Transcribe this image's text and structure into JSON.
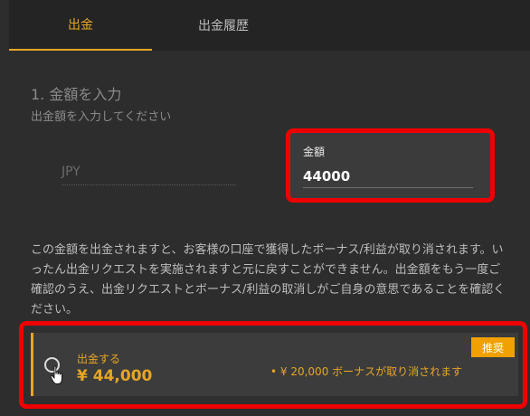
{
  "tabs": [
    {
      "label": "出金",
      "active": true
    },
    {
      "label": "出金履歴",
      "active": false
    }
  ],
  "step": {
    "title": "1. 金額を入力",
    "subtitle": "出金額を入力してください"
  },
  "currency": "JPY",
  "amount_field": {
    "label": "金額",
    "value": "44000"
  },
  "notice": "この金額を出金されますと、お客様の口座で獲得したボーナス/利益が取り消されます。いったん出金リクエストを実施されますと元に戻すことができません。出金額をもう一度ご確認のうえ、出金リクエストとボーナス/利益の取消しがご自身の意思であることを確認ください。",
  "option": {
    "label": "出金する",
    "amount": "¥ 44,000",
    "note": "•  ¥ 20,000 ボーナスが取り消されます",
    "badge": "推奨"
  },
  "colors": {
    "accent": "#e6a623",
    "highlight": "#ee0000",
    "badge": "#f0a000"
  }
}
